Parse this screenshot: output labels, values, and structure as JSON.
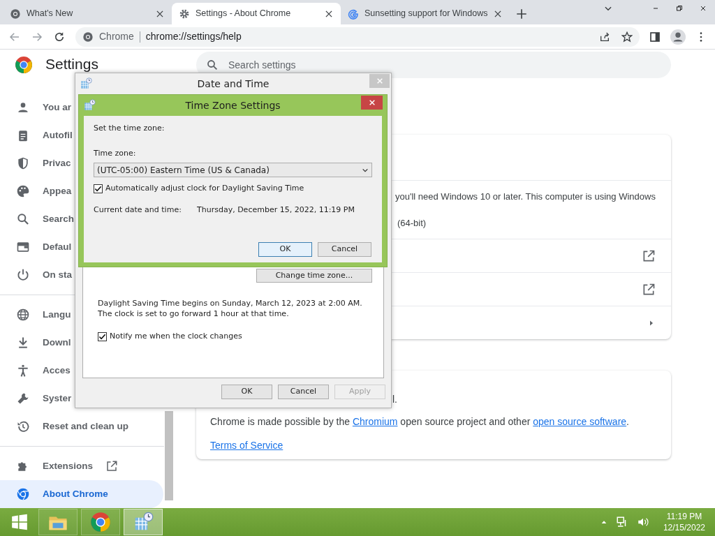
{
  "browser": {
    "tabs": [
      {
        "title": "What's New",
        "kind": "chrome",
        "selected": false
      },
      {
        "title": "Settings - About Chrome",
        "kind": "gear",
        "selected": true
      },
      {
        "title": "Sunsetting support for Windows",
        "kind": "google",
        "selected": false
      }
    ],
    "address": {
      "site": "Chrome",
      "url": "chrome://settings/help"
    }
  },
  "settings": {
    "title": "Settings",
    "search_placeholder": "Search settings",
    "sidebar": [
      [
        {
          "label": "You ar",
          "selected": false
        },
        {
          "label": "Autofil",
          "selected": false
        },
        {
          "label": "Privac",
          "selected": false
        },
        {
          "label": "Appea",
          "selected": false
        },
        {
          "label": "Search",
          "selected": false
        },
        {
          "label": "Defaul",
          "selected": false
        },
        {
          "label": "On sta",
          "selected": false
        }
      ],
      [
        {
          "label": "Langu",
          "selected": false
        },
        {
          "label": "Downl",
          "selected": false
        },
        {
          "label": "Acces",
          "selected": false
        },
        {
          "label": "Syster",
          "selected": false
        },
        {
          "label": "Reset and clean up",
          "selected": false
        }
      ],
      [
        {
          "label": "Extensions",
          "selected": false,
          "external": true
        },
        {
          "label": "About Chrome",
          "selected": true
        }
      ]
    ],
    "about_rows": [
      {
        "kind": "text",
        "lines": [
          "you'll need Windows 10 or later. This computer is using Windows",
          "(64-bit)"
        ]
      },
      {
        "kind": "external"
      },
      {
        "kind": "external"
      },
      {
        "kind": "arrow"
      }
    ],
    "legal": {
      "fragment": "l.",
      "credits": [
        {
          "text": "Chrome is made possible by the ",
          "link": false
        },
        {
          "text": "Chromium",
          "link": true
        },
        {
          "text": " open source project and other ",
          "link": false
        },
        {
          "text": "open source software",
          "link": true
        },
        {
          "text": ".",
          "link": false
        }
      ],
      "terms": "Terms of Service"
    }
  },
  "date_time_dialog": {
    "title": "Date and Time",
    "change_button": "Change time zone...",
    "dst_message": "Daylight Saving Time begins on Sunday, March 12, 2023 at 2:00 AM. The clock is set to go forward 1 hour at that time.",
    "notify": {
      "label": "Notify me when the clock changes",
      "checked": true
    },
    "buttons": [
      {
        "label": "OK",
        "disabled": false
      },
      {
        "label": "Cancel",
        "disabled": false
      },
      {
        "label": "Apply",
        "disabled": true
      }
    ]
  },
  "time_zone_dialog": {
    "title": "Time Zone Settings",
    "prompt": "Set the time zone:",
    "zone_label": "Time zone:",
    "zone_value": "(UTC-05:00) Eastern Time (US & Canada)",
    "auto_dst": {
      "label": "Automatically adjust clock for Daylight Saving Time",
      "checked": true
    },
    "current_label": "Current date and time:",
    "current_value": "Thursday, December 15, 2022, 11:19 PM",
    "buttons": [
      {
        "label": "OK",
        "default": true
      },
      {
        "label": "Cancel",
        "default": false
      }
    ]
  },
  "taskbar": {
    "apps": [
      {
        "kind": "folder",
        "selected": false
      },
      {
        "kind": "chrome",
        "selected": false
      },
      {
        "kind": "calendar",
        "selected": true
      }
    ],
    "time": "11:19 PM",
    "date": "12/15/2022"
  }
}
